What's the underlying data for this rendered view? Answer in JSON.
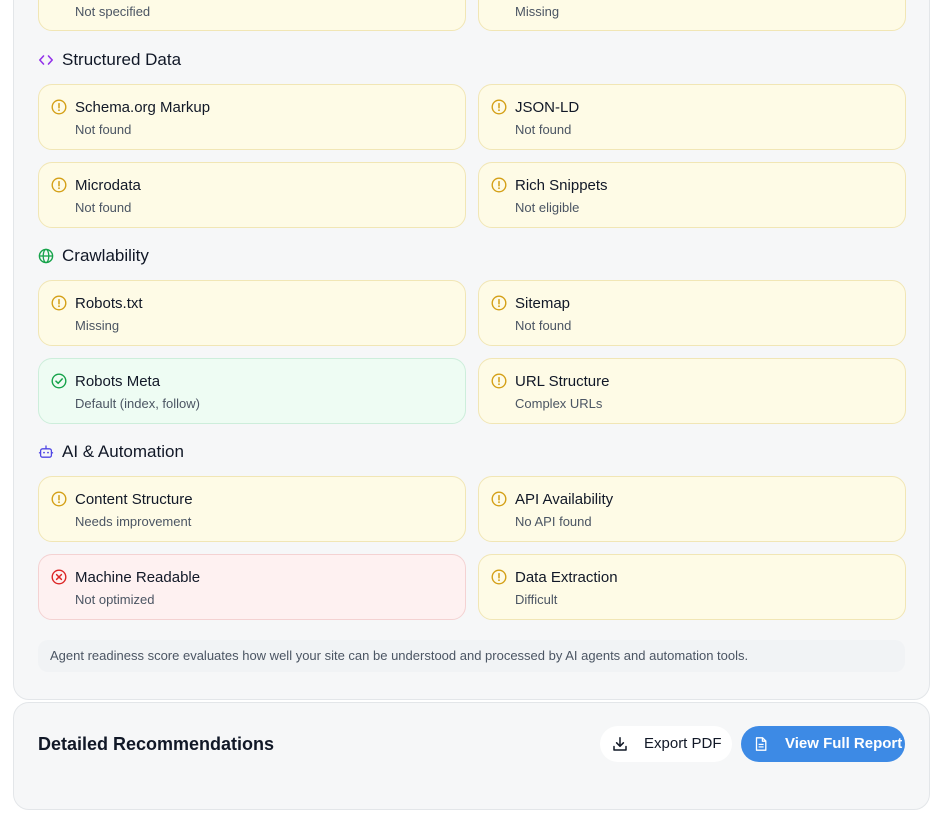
{
  "colors": {
    "warning": "#d4a017",
    "success": "#16a34a",
    "error": "#dc2626",
    "structured_icon": "#9333ea",
    "crawl_icon": "#16a34a",
    "ai_icon": "#4f46e5",
    "primary": "#3d8ae5"
  },
  "top_cards": [
    {
      "subtitle": "Not specified",
      "status": "warning"
    },
    {
      "subtitle": "Missing",
      "status": "warning"
    }
  ],
  "sections": [
    {
      "title": "Structured Data",
      "icon": "code-icon",
      "cards": [
        {
          "title": "Schema.org Markup",
          "subtitle": "Not found",
          "status": "warning",
          "icon": "warning-circle-icon"
        },
        {
          "title": "JSON-LD",
          "subtitle": "Not found",
          "status": "warning",
          "icon": "warning-circle-icon"
        },
        {
          "title": "Microdata",
          "subtitle": "Not found",
          "status": "warning",
          "icon": "warning-circle-icon"
        },
        {
          "title": "Rich Snippets",
          "subtitle": "Not eligible",
          "status": "warning",
          "icon": "warning-circle-icon"
        }
      ]
    },
    {
      "title": "Crawlability",
      "icon": "globe-icon",
      "cards": [
        {
          "title": "Robots.txt",
          "subtitle": "Missing",
          "status": "warning",
          "icon": "warning-circle-icon"
        },
        {
          "title": "Sitemap",
          "subtitle": "Not found",
          "status": "warning",
          "icon": "warning-circle-icon"
        },
        {
          "title": "Robots Meta",
          "subtitle": "Default (index, follow)",
          "status": "success",
          "icon": "check-circle-icon"
        },
        {
          "title": "URL Structure",
          "subtitle": "Complex URLs",
          "status": "warning",
          "icon": "warning-circle-icon"
        }
      ]
    },
    {
      "title": "AI & Automation",
      "icon": "bot-icon",
      "cards": [
        {
          "title": "Content Structure",
          "subtitle": "Needs improvement",
          "status": "warning",
          "icon": "warning-circle-icon"
        },
        {
          "title": "API Availability",
          "subtitle": "No API found",
          "status": "warning",
          "icon": "warning-circle-icon"
        },
        {
          "title": "Machine Readable",
          "subtitle": "Not optimized",
          "status": "error",
          "icon": "x-circle-icon"
        },
        {
          "title": "Data Extraction",
          "subtitle": "Difficult",
          "status": "warning",
          "icon": "warning-circle-icon"
        }
      ]
    }
  ],
  "note": "Agent readiness score evaluates how well your site can be understood and processed by AI agents and automation tools.",
  "recommendations": {
    "title": "Detailed Recommendations",
    "export_label": "Export PDF",
    "view_label": "View Full Report"
  }
}
